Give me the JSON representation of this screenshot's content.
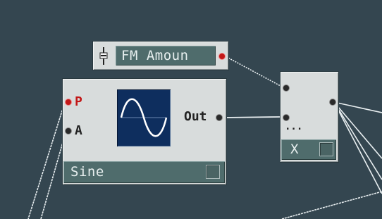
{
  "fm_amount": {
    "label": "FM Amoun",
    "slider_icon": "slider-icon"
  },
  "sine_module": {
    "inputs": [
      {
        "label": "P",
        "color": "#c21818"
      },
      {
        "label": "A",
        "color": "#222222"
      }
    ],
    "output_label": "Out",
    "name": "Sine",
    "display_icon": "sine-wave-icon"
  },
  "multiply_module": {
    "name": "X",
    "more_indicator": "..."
  },
  "colors": {
    "canvas": "#344650",
    "module": "#d8dcdc",
    "strip": "#4f6c6c",
    "screen": "#0e2e5e",
    "wire": "#e8eef0"
  }
}
